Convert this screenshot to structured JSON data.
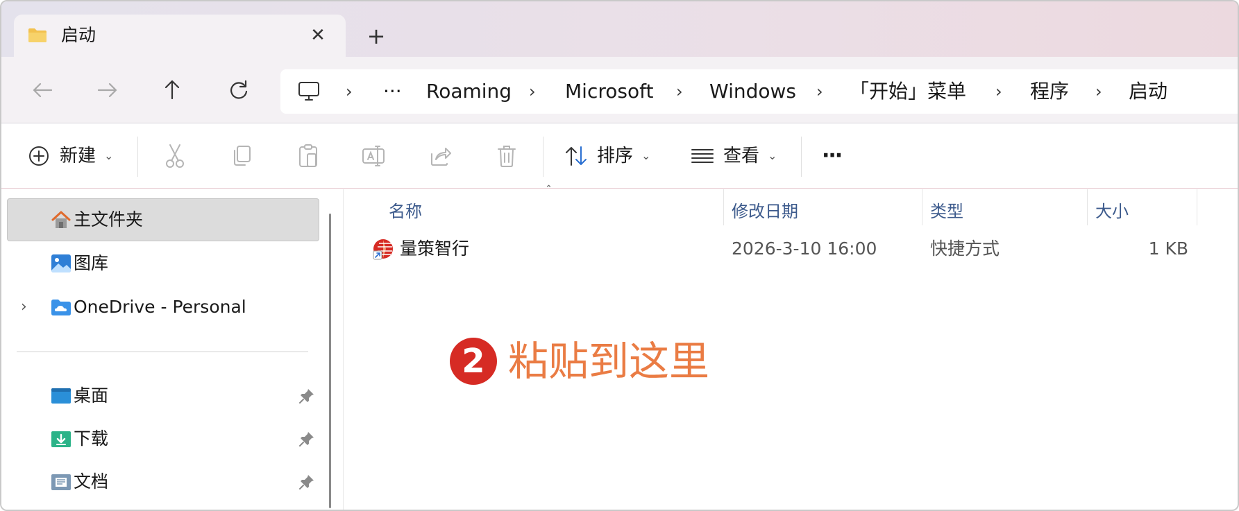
{
  "tab": {
    "title": "启动",
    "close_glyph": "✕",
    "new_tab_glyph": "+"
  },
  "nav": {
    "back_icon": "arrow-left-icon",
    "forward_icon": "arrow-right-icon",
    "up_icon": "arrow-up-icon",
    "refresh_icon": "refresh-icon"
  },
  "address": {
    "overflow": "···",
    "crumbs": [
      "Roaming",
      "Microsoft",
      "Windows",
      "「开始」菜单",
      "程序",
      "启动"
    ],
    "separator": "›"
  },
  "toolbar": {
    "new_label": "新建",
    "sort_label": "排序",
    "view_label": "查看",
    "more_glyph": "···"
  },
  "sidebar": {
    "items": [
      {
        "label": "主文件夹",
        "icon": "home-icon",
        "selected": true
      },
      {
        "label": "图库",
        "icon": "gallery-icon"
      },
      {
        "label": "OneDrive - Personal",
        "icon": "onedrive-icon",
        "expandable": true
      }
    ],
    "pinned": [
      {
        "label": "桌面",
        "icon": "desktop-folder-icon"
      },
      {
        "label": "下载",
        "icon": "downloads-folder-icon"
      },
      {
        "label": "文档",
        "icon": "documents-folder-icon"
      }
    ]
  },
  "columns": [
    "名称",
    "修改日期",
    "类型",
    "大小"
  ],
  "files": [
    {
      "name": "量策智行",
      "modified": "2026-3-10 16:00",
      "type": "快捷方式",
      "size": "1 KB"
    }
  ],
  "annotation": {
    "number": "2",
    "text": "粘贴到这里"
  },
  "colors": {
    "accent": "#d62b24",
    "annotation_text": "#ea7c44",
    "header_text": "#3c5a8c"
  }
}
